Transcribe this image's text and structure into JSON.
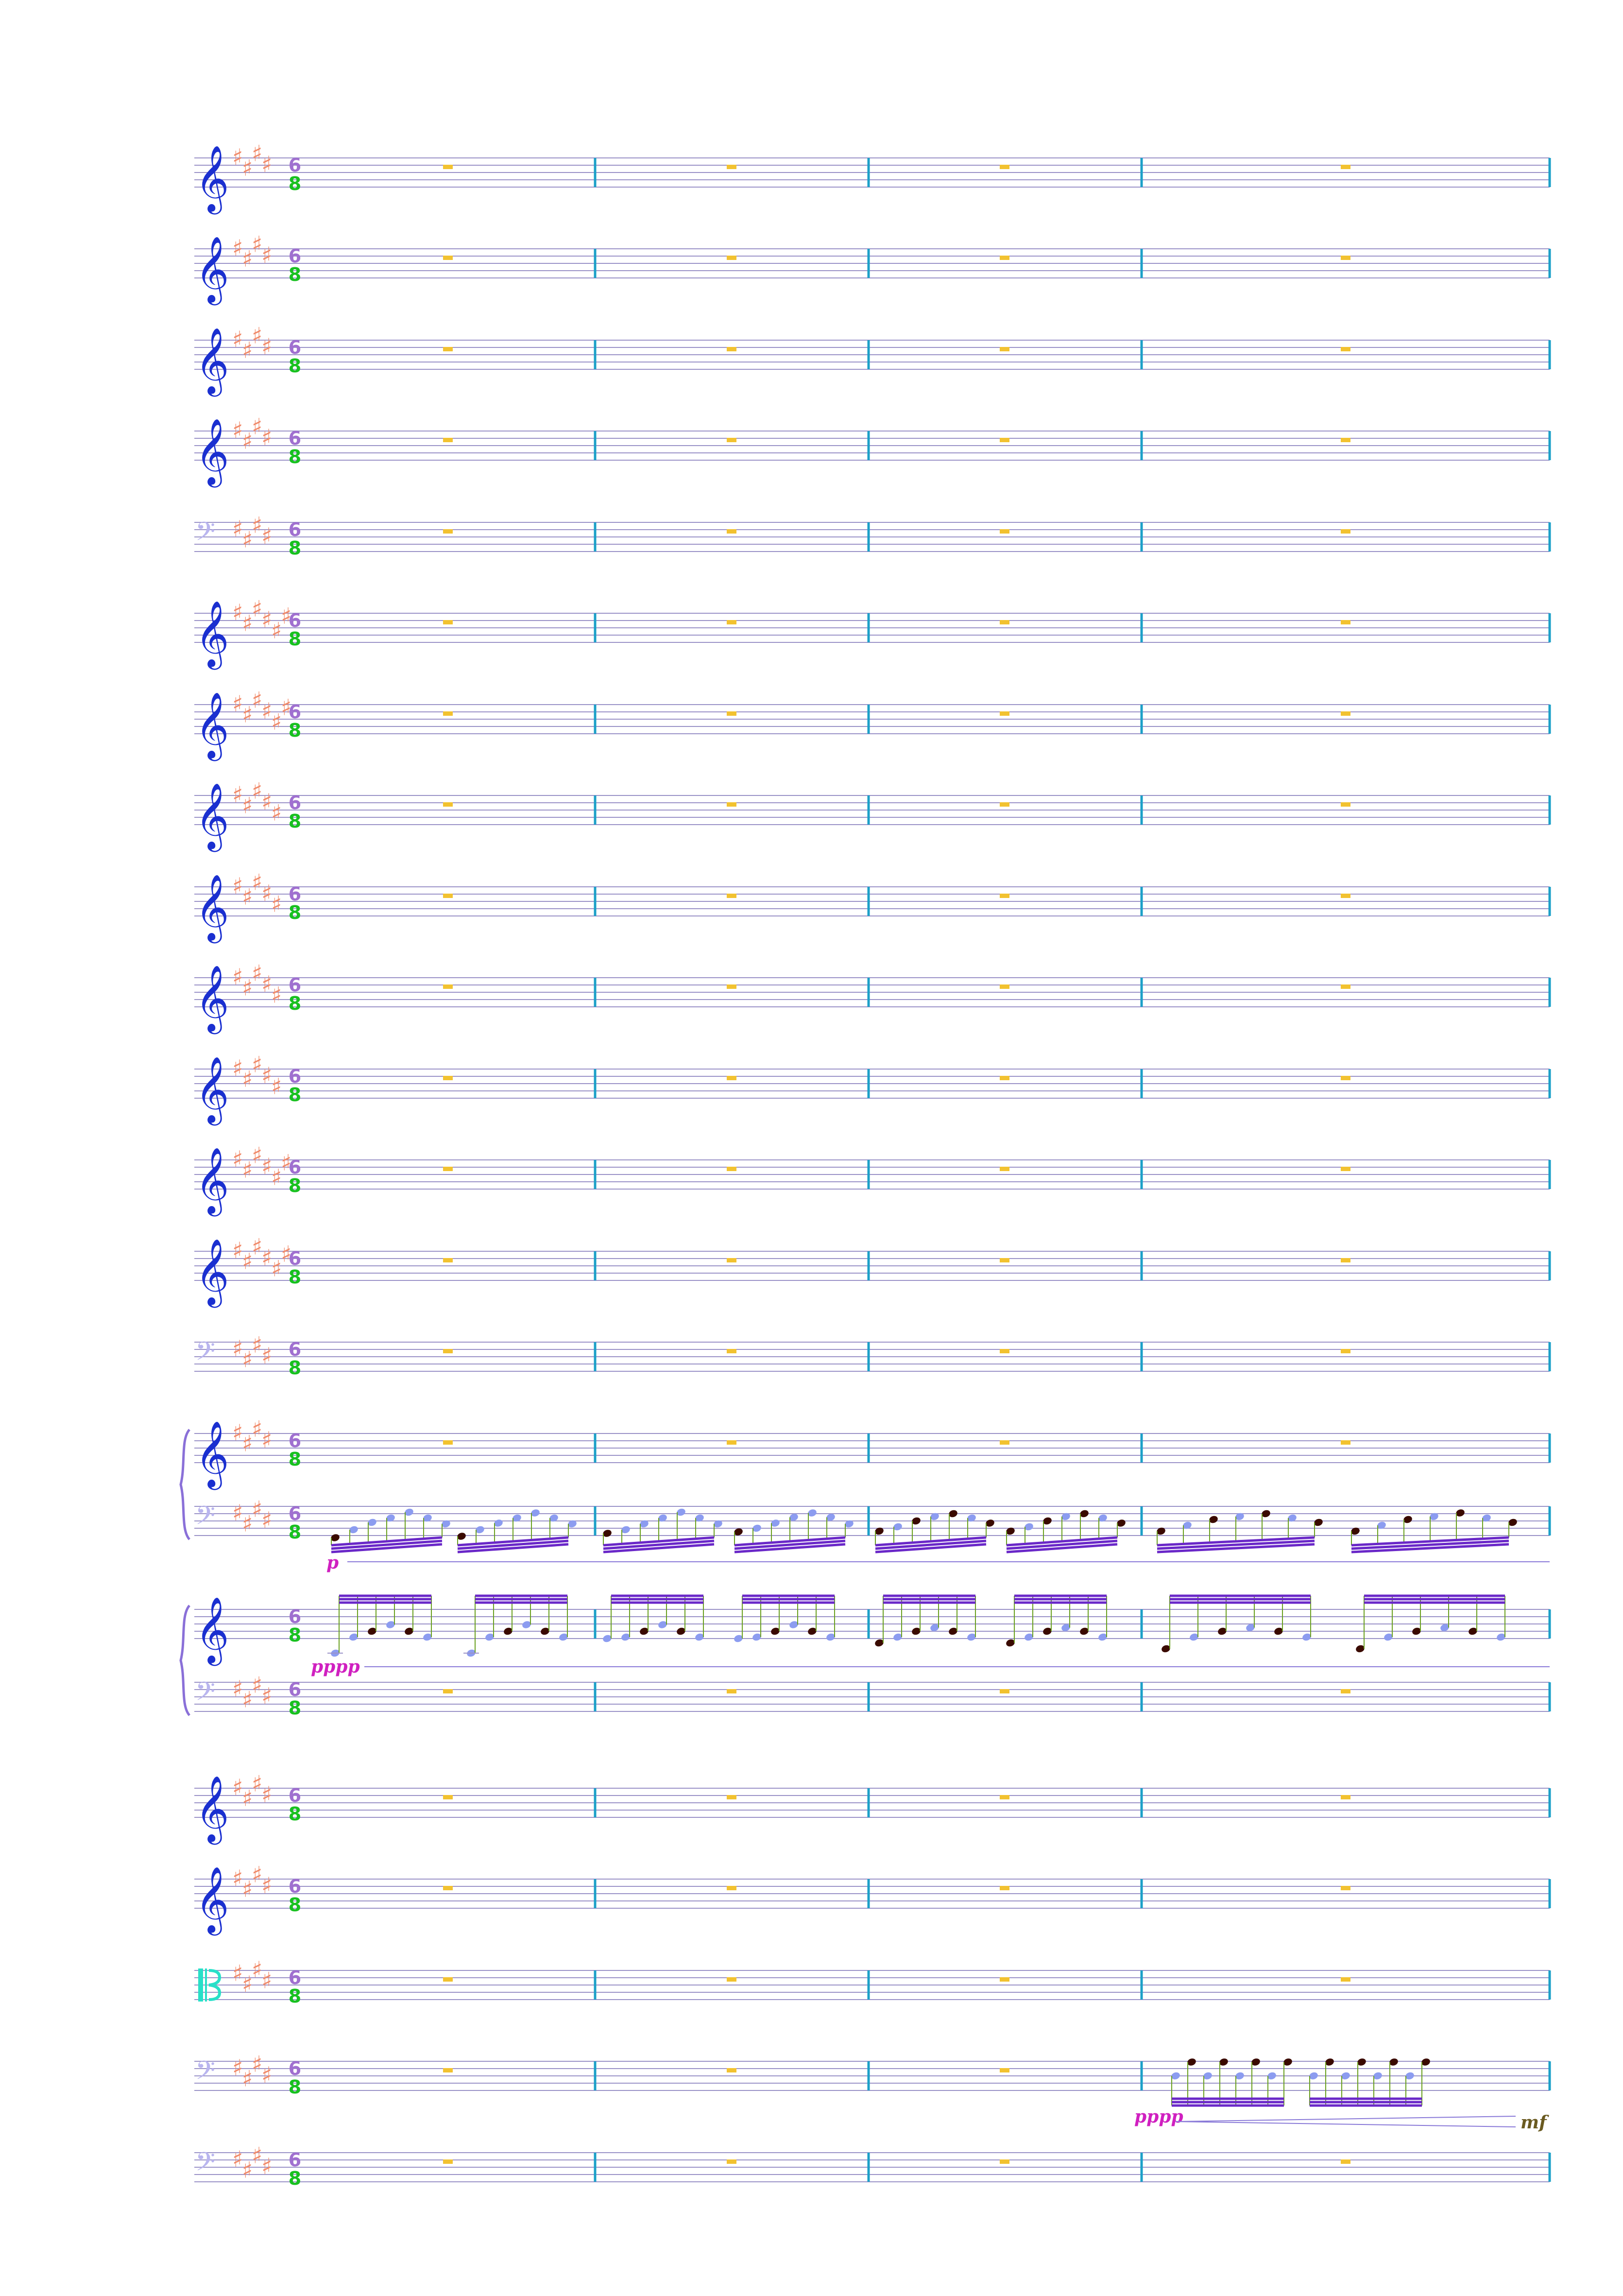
{
  "score": {
    "time_signature": {
      "numerator": "6",
      "denominator": "8"
    },
    "measures_per_system": 4,
    "staves": [
      {
        "id": "staff-1",
        "clef": "treble",
        "sharps": 4,
        "content": "rests"
      },
      {
        "id": "staff-2",
        "clef": "treble",
        "sharps": 4,
        "content": "rests"
      },
      {
        "id": "staff-3",
        "clef": "treble",
        "sharps": 4,
        "content": "rests"
      },
      {
        "id": "staff-4",
        "clef": "treble",
        "sharps": 4,
        "content": "rests"
      },
      {
        "id": "staff-5",
        "clef": "bass",
        "sharps": 4,
        "content": "rests"
      },
      {
        "id": "staff-6",
        "clef": "treble",
        "sharps": 6,
        "content": "rests"
      },
      {
        "id": "staff-7",
        "clef": "treble",
        "sharps": 6,
        "content": "rests"
      },
      {
        "id": "staff-8",
        "clef": "treble",
        "sharps": 5,
        "content": "rests"
      },
      {
        "id": "staff-9",
        "clef": "treble",
        "sharps": 5,
        "content": "rests"
      },
      {
        "id": "staff-10",
        "clef": "treble",
        "sharps": 5,
        "content": "rests"
      },
      {
        "id": "staff-11",
        "clef": "treble",
        "sharps": 5,
        "content": "rests"
      },
      {
        "id": "staff-12",
        "clef": "treble",
        "sharps": 6,
        "content": "rests"
      },
      {
        "id": "staff-13",
        "clef": "treble",
        "sharps": 6,
        "content": "rests"
      },
      {
        "id": "staff-14",
        "clef": "bass",
        "sharps": 4,
        "content": "rests"
      },
      {
        "id": "piano1-upper",
        "clef": "treble",
        "sharps": 4,
        "content": "rests",
        "brace": "piano1"
      },
      {
        "id": "piano1-lower",
        "clef": "bass",
        "sharps": 4,
        "content": "arpeggio-bass",
        "brace": "piano1",
        "dynamic": "p"
      },
      {
        "id": "piano2-upper",
        "clef": "treble",
        "sharps": 0,
        "content": "arpeggio-treble",
        "brace": "piano2",
        "dynamic": "pppp"
      },
      {
        "id": "piano2-lower",
        "clef": "bass",
        "sharps": 4,
        "content": "rests",
        "brace": "piano2"
      },
      {
        "id": "staff-19",
        "clef": "treble",
        "sharps": 4,
        "content": "rests"
      },
      {
        "id": "staff-20",
        "clef": "treble",
        "sharps": 4,
        "content": "rests"
      },
      {
        "id": "staff-21",
        "clef": "alto",
        "sharps": 4,
        "content": "rests"
      },
      {
        "id": "staff-22",
        "clef": "bass",
        "sharps": 4,
        "content": "tremolo-last",
        "dynamic": "pppp",
        "dynamic_end": "mf"
      },
      {
        "id": "staff-23",
        "clef": "bass",
        "sharps": 4,
        "content": "rests"
      }
    ]
  },
  "colors": {
    "staff_line": "#9b93c8",
    "barline": "#1ca0c8",
    "rest": "#f2c230",
    "key_sig": "#f08a6a",
    "treble_clef": "#1a2fd0",
    "bass_clef": "#b9b5ef",
    "alto_clef": "#28e0c8",
    "time_num": "#a070d0",
    "time_den": "#18c020",
    "note_dark": "#3a0a00",
    "note_light": "#8c9cf0",
    "beam": "#6a28c8",
    "stem": "#6aa020",
    "dynamic": "#d020c0",
    "hairpin": "#8a7ad8",
    "brace": "#8a70d8",
    "mf": "#6a5a20"
  }
}
